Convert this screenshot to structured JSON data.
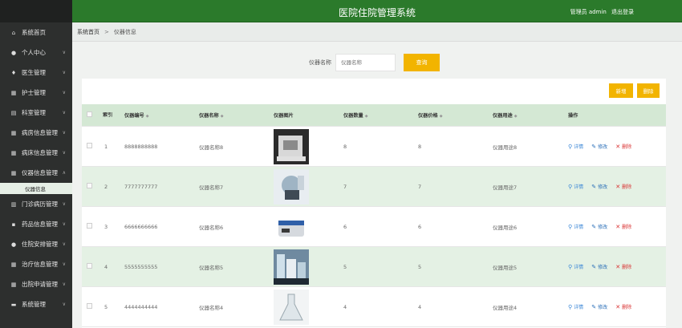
{
  "header": {
    "title": "医院住院管理系统",
    "user": "管理员 admin",
    "logout": "退出登录"
  },
  "sidebar": {
    "items": [
      {
        "label": "系统首页",
        "icon": "home-icon",
        "expandable": false
      },
      {
        "label": "个人中心",
        "icon": "user-icon",
        "expandable": true
      },
      {
        "label": "医生管理",
        "icon": "doctor-icon",
        "expandable": true
      },
      {
        "label": "护士管理",
        "icon": "grid-icon",
        "expandable": true
      },
      {
        "label": "科室管理",
        "icon": "building-icon",
        "expandable": true
      },
      {
        "label": "病房信息管理",
        "icon": "grid-icon",
        "expandable": true
      },
      {
        "label": "病床信息管理",
        "icon": "grid-icon",
        "expandable": true
      },
      {
        "label": "仪器信息管理",
        "icon": "grid-icon",
        "expandable": true,
        "expanded": true,
        "sub": [
          "仪器信息"
        ]
      },
      {
        "label": "门诊病历管理",
        "icon": "doc-icon",
        "expandable": true
      },
      {
        "label": "药品信息管理",
        "icon": "pill-icon",
        "expandable": true
      },
      {
        "label": "住院安排管理",
        "icon": "person-icon",
        "expandable": true
      },
      {
        "label": "治疗信息管理",
        "icon": "grid-icon",
        "expandable": true
      },
      {
        "label": "出院申请管理",
        "icon": "grid-icon",
        "expandable": true
      },
      {
        "label": "系统管理",
        "icon": "chat-icon",
        "expandable": true
      }
    ]
  },
  "breadcrumb": {
    "home": "系统首页",
    "sep": ">",
    "current": "仪器信息"
  },
  "search": {
    "label": "仪器名称",
    "placeholder": "仪器名称",
    "button": "查询"
  },
  "actions": {
    "add": "新增",
    "delete": "删除"
  },
  "table": {
    "headers": {
      "index": "索引",
      "code": "仪器编号",
      "name": "仪器名称",
      "image": "仪器图片",
      "qty": "仪器数量",
      "price": "仪器价格",
      "usage": "仪器用途",
      "ops": "操作"
    },
    "ops": {
      "detail": "详情",
      "edit": "修改",
      "delete": "删除"
    },
    "rows": [
      {
        "index": "1",
        "code": "8888888888",
        "name": "仪器名称8",
        "qty": "8",
        "price": "8",
        "usage": "仪器用途8",
        "image": "equipment-photo"
      },
      {
        "index": "2",
        "code": "7777777777",
        "name": "仪器名称7",
        "qty": "7",
        "price": "7",
        "usage": "仪器用途7",
        "image": "equipment-photo"
      },
      {
        "index": "3",
        "code": "6666666666",
        "name": "仪器名称6",
        "qty": "6",
        "price": "6",
        "usage": "仪器用途6",
        "image": "equipment-photo"
      },
      {
        "index": "4",
        "code": "5555555555",
        "name": "仪器名称5",
        "qty": "5",
        "price": "5",
        "usage": "仪器用途5",
        "image": "equipment-photo"
      },
      {
        "index": "5",
        "code": "4444444444",
        "name": "仪器名称4",
        "qty": "4",
        "price": "4",
        "usage": "仪器用途4",
        "image": "equipment-photo"
      }
    ]
  },
  "colors": {
    "header": "#2b7a2b",
    "sidebar": "#2d2f2e",
    "accent": "#f2b400",
    "row_alt": "#e4f1e4"
  }
}
